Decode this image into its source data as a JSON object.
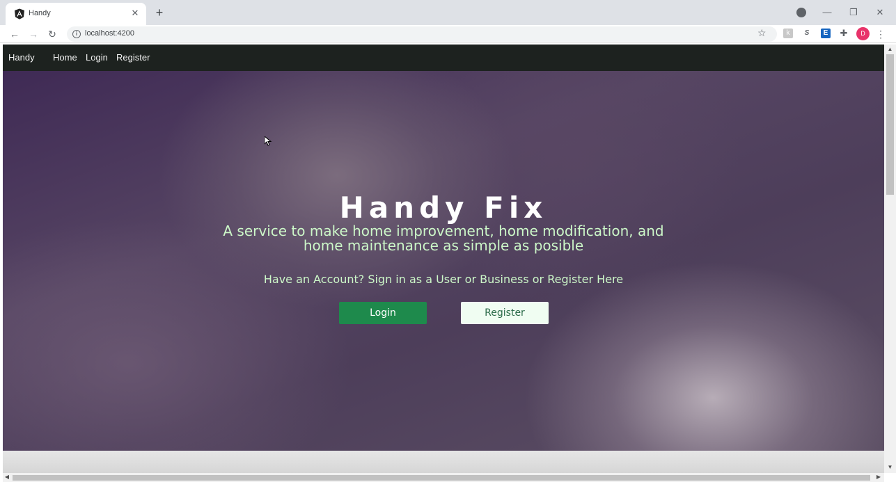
{
  "browser": {
    "tab_title": "Handy",
    "url": "localhost:4200",
    "profile_initial": "D"
  },
  "navbar": {
    "brand": "Handy",
    "links": [
      "Home",
      "Login",
      "Register"
    ]
  },
  "hero": {
    "title": "Handy Fix",
    "subtitle": "A service to make home improvement, home modification, and home maintenance as simple as posible",
    "prompt": "Have an Account? Sign in as a User or Business or Register Here",
    "login_button": "Login",
    "register_button": "Register"
  },
  "colors": {
    "navbar_bg": "#1d221f",
    "accent_green": "#1e8a4c",
    "hero_text_green": "#ccf7c8",
    "profile_pink": "#e8336a"
  },
  "icons": [
    "angular-favicon-icon",
    "close-icon",
    "plus-icon",
    "back-icon",
    "forward-icon",
    "reload-icon",
    "info-icon",
    "star-icon",
    "extension-icon",
    "menu-icon"
  ]
}
